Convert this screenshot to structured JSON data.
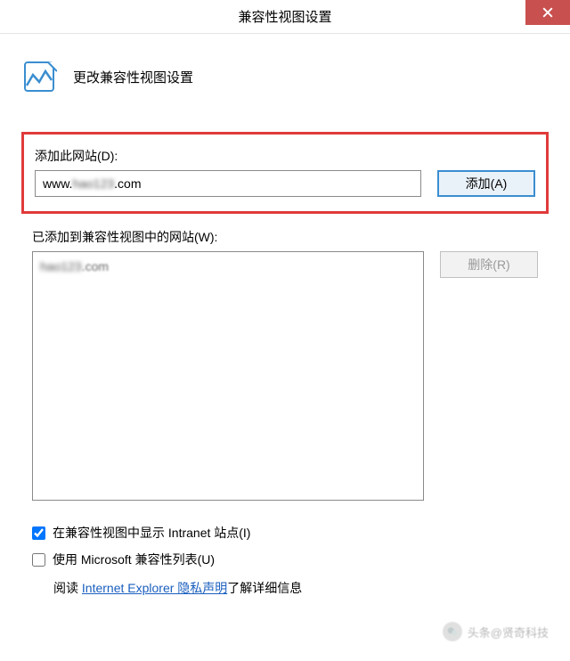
{
  "titlebar": {
    "title": "兼容性视图设置"
  },
  "header": {
    "text": "更改兼容性视图设置"
  },
  "add_section": {
    "label": "添加此网站(D):",
    "input_value": "www.hao123.com",
    "add_button": "添加(A)"
  },
  "list_section": {
    "label": "已添加到兼容性视图中的网站(W):",
    "items": [
      "hao123.com"
    ],
    "remove_button": "删除(R)"
  },
  "options": {
    "intranet_checkbox": "在兼容性视图中显示 Intranet 站点(I)",
    "intranet_checked": true,
    "mslist_checkbox": "使用 Microsoft 兼容性列表(U)",
    "mslist_checked": false
  },
  "link_row": {
    "prefix": "阅读 ",
    "link_text": "Internet Explorer 隐私声明",
    "suffix": "了解详细信息"
  },
  "watermark": {
    "text": "头条@贤奇科技"
  }
}
